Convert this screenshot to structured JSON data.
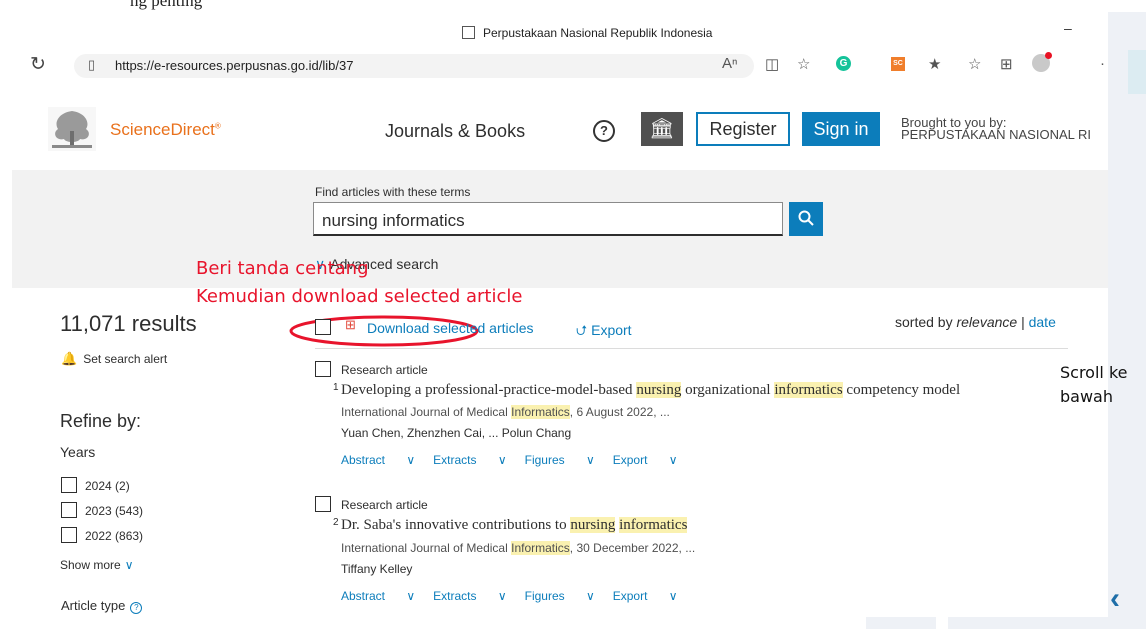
{
  "browser": {
    "window_title": "Perpustakaan Nasional Republik Indonesia",
    "url": "https://e-resources.perpusnas.go.id/lib/37",
    "minimize": "–",
    "icons": [
      "reload-icon",
      "lock-icon",
      "read-aloud-icon",
      "reader-icon",
      "favorite-add-icon",
      "grammarly-icon",
      "scite-icon",
      "extensions-icon",
      "favorites-icon",
      "collections-icon",
      "profile-icon",
      "more-icon"
    ]
  },
  "header": {
    "brand": "ScienceDirect",
    "brand_mark": "®",
    "journals_books": "Journals & Books",
    "register": "Register",
    "sign_in": "Sign in",
    "brought_by_1": "Brought to you by:",
    "brought_by_2": "PERPUSTAKAAN NASIONAL RI"
  },
  "search": {
    "label": "Find articles with these terms",
    "query": "nursing informatics",
    "advanced": "Advanced search"
  },
  "annotations": {
    "line1": "Beri tanda centang",
    "line2": "Kemudian download selected article",
    "scroll_1": "Scroll ke",
    "scroll_2": "bawah",
    "color": "#e8142c"
  },
  "sidebar": {
    "results": "11,071 results",
    "alert": "Set search alert",
    "refine": "Refine by:",
    "years_label": "Years",
    "years": [
      {
        "label": "2024 (2)"
      },
      {
        "label": "2023 (543)"
      },
      {
        "label": "2022 (863)"
      }
    ],
    "show_more": "Show more",
    "article_type": "Article type"
  },
  "toolbar": {
    "download": "Download selected articles",
    "export": "Export",
    "sorted_by": "sorted by",
    "relevance": "relevance",
    "separator": "|",
    "date": "date"
  },
  "results": [
    {
      "type": "Research article",
      "num": "1",
      "title_parts": [
        "Developing a professional-practice-model-based ",
        "nursing",
        " organizational ",
        "informatics",
        " competency model"
      ],
      "journal_parts": [
        "International Journal of Medical ",
        "Informatics",
        ", 6 August 2022, ..."
      ],
      "authors": "Yuan Chen, Zhenzhen Cai, ... Polun Chang",
      "actions": [
        "Abstract",
        "Extracts",
        "Figures",
        "Export"
      ]
    },
    {
      "type": "Research article",
      "num": "2",
      "title_parts": [
        "Dr. Saba's innovative contributions to ",
        "nursing",
        " ",
        "informatics",
        ""
      ],
      "journal_parts": [
        "International Journal of Medical ",
        "Informatics",
        ", 30 December 2022, ..."
      ],
      "authors": "Tiffany Kelley",
      "actions": [
        "Abstract",
        "Extracts",
        "Figures",
        "Export"
      ]
    }
  ],
  "colors": {
    "brand_orange": "#e9711c",
    "link_blue": "#0c7dbb",
    "highlight": "#faf1b0"
  }
}
